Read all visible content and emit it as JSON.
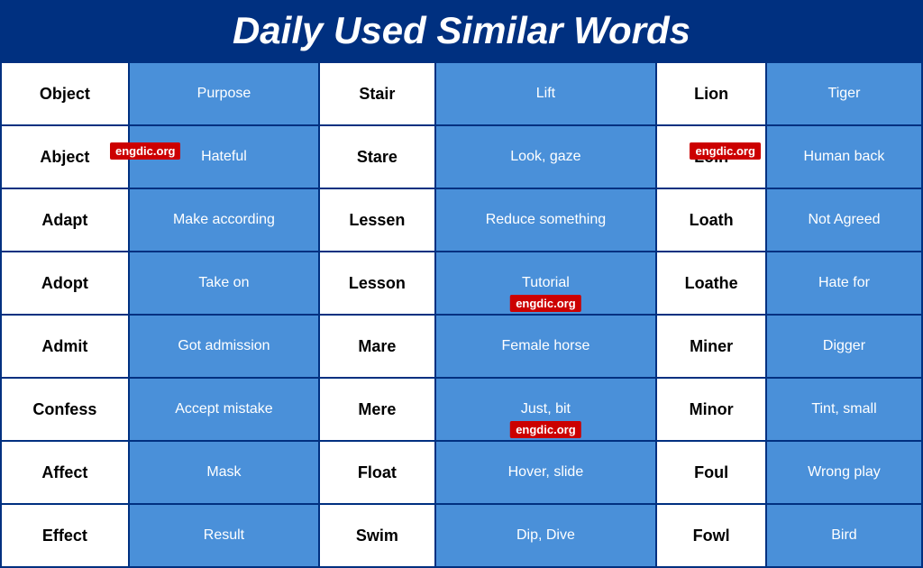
{
  "header": {
    "title": "Daily Used Similar Words"
  },
  "watermarks": [
    "engdic.org",
    "engdic.org",
    "engdic.org",
    "engdic.org"
  ],
  "rows": [
    [
      {
        "word": "Object",
        "def": "Purpose",
        "word2": "Stair",
        "def2": "Lift",
        "word3": "Lion",
        "def3": "Tiger"
      }
    ],
    [
      {
        "word": "Abject",
        "def": "Hateful",
        "word2": "Stare",
        "def2": "Look, gaze",
        "word3": "Loin",
        "def3": "Human back",
        "wm1": true,
        "wm2": true
      }
    ],
    [
      {
        "word": "Adapt",
        "def": "Make according",
        "word2": "Lessen",
        "def2": "Reduce something",
        "word3": "Loath",
        "def3": "Not Agreed"
      }
    ],
    [
      {
        "word": "Adopt",
        "def": "Take on",
        "word2": "Lesson",
        "def2": "Tutorial",
        "word3": "Loathe",
        "def3": "Hate for",
        "wm3": true
      }
    ],
    [
      {
        "word": "Admit",
        "def": "Got admission",
        "word2": "Mare",
        "def2": "Female horse",
        "word3": "Miner",
        "def3": "Digger"
      }
    ],
    [
      {
        "word": "Confess",
        "def": "Accept mistake",
        "word2": "Mere",
        "def2": "Just, bit",
        "word3": "Minor",
        "def3": "Tint, small",
        "wm4": true
      }
    ],
    [
      {
        "word": "Affect",
        "def": "Mask",
        "word2": "Float",
        "def2": "Hover, slide",
        "word3": "Foul",
        "def3": "Wrong play"
      }
    ],
    [
      {
        "word": "Effect",
        "def": "Result",
        "word2": "Swim",
        "def2": "Dip, Dive",
        "word3": "Fowl",
        "def3": "Bird"
      }
    ]
  ]
}
